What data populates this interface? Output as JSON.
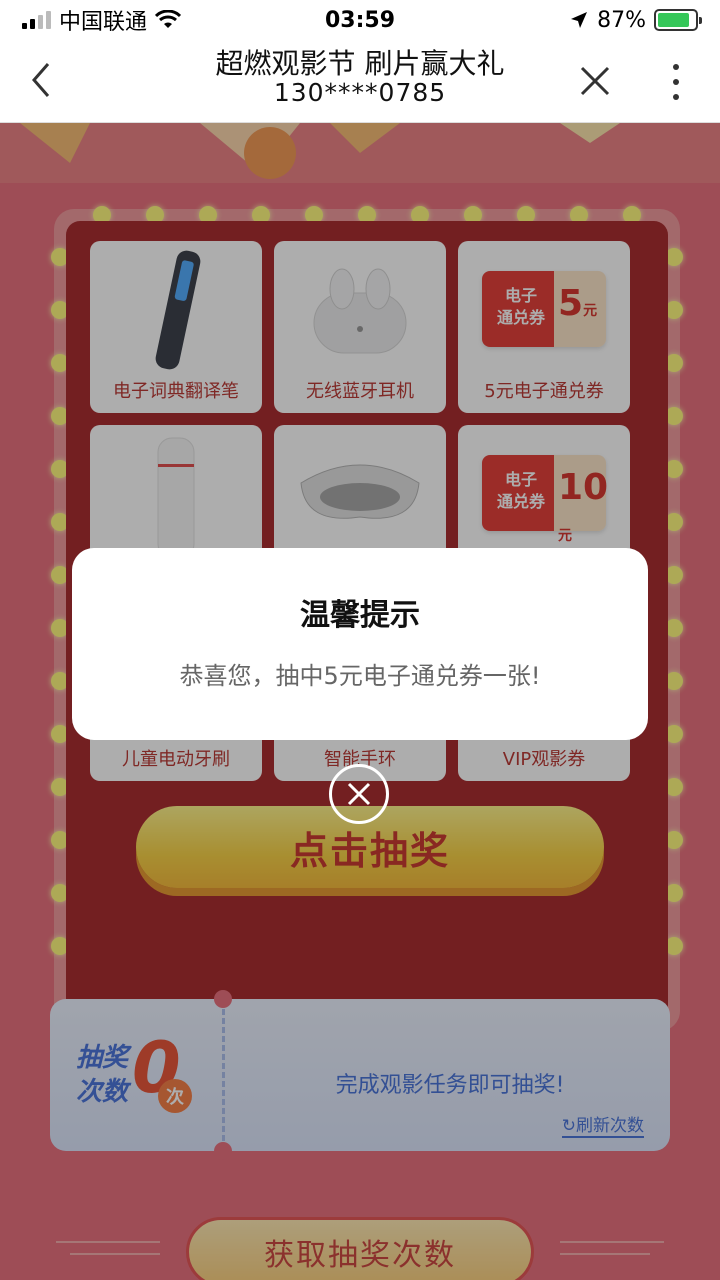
{
  "status_bar": {
    "carrier": "中国联通",
    "time": "03:59",
    "battery": "87%",
    "battery_level": 0.87
  },
  "nav": {
    "title": "超燃观影节 刷片赢大礼",
    "subtitle": "130****0785"
  },
  "prizes": [
    {
      "label": "电子词典翻译笔"
    },
    {
      "label": "无线蓝牙耳机"
    },
    {
      "label": "5元电子通兑券",
      "coupon_text_1": "电子",
      "coupon_text_2": "通兑券",
      "coupon_amount": "5",
      "coupon_unit": "元"
    },
    {
      "label": "儿童电动牙刷"
    },
    {
      "label": "智能手环"
    },
    {
      "label": "VIP观影券",
      "coupon_text_1": "电子",
      "coupon_text_2": "通兑券",
      "coupon_amount": "10",
      "coupon_unit": "元"
    }
  ],
  "draw_button": "点击抽奖",
  "ticket": {
    "title_line1": "抽奖",
    "title_line2": "次数",
    "count": "0",
    "unit": "次",
    "message": "完成观影任务即可抽奖!",
    "refresh": "刷新次数"
  },
  "get_button": "获取抽奖次数",
  "dialog": {
    "title": "温馨提示",
    "message": "恭喜您，抽中5元电子通兑券一张!"
  },
  "colors": {
    "page_bg": "#e55a69",
    "board_inner": "#9c0b0e",
    "accent_yellow": "#f7cb2a",
    "ticket_blue": "#2e5fd4"
  }
}
